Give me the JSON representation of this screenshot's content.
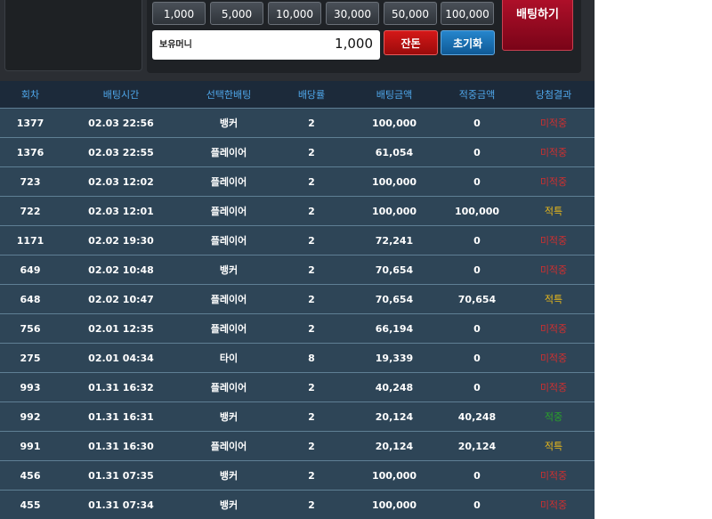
{
  "chips": [
    "1,000",
    "5,000",
    "10,000",
    "30,000",
    "50,000",
    "100,000"
  ],
  "money": {
    "label": "보유머니",
    "value": "1,000"
  },
  "buttons": {
    "change": "잔돈",
    "reset": "초기화",
    "bet": "배팅하기"
  },
  "table": {
    "headers": [
      "회차",
      "배팅시간",
      "선택한배팅",
      "배당률",
      "배팅금액",
      "적중금액",
      "당첨결과"
    ],
    "rows": [
      {
        "round": "1377",
        "time": "02.03 22:56",
        "choice": "뱅커",
        "odds": "2",
        "bet": "100,000",
        "win": "0",
        "result": "미적중",
        "status": "lose"
      },
      {
        "round": "1376",
        "time": "02.03 22:55",
        "choice": "플레이어",
        "odds": "2",
        "bet": "61,054",
        "win": "0",
        "result": "미적중",
        "status": "lose"
      },
      {
        "round": "723",
        "time": "02.03 12:02",
        "choice": "플레이어",
        "odds": "2",
        "bet": "100,000",
        "win": "0",
        "result": "미적중",
        "status": "lose"
      },
      {
        "round": "722",
        "time": "02.03 12:01",
        "choice": "플레이어",
        "odds": "2",
        "bet": "100,000",
        "win": "100,000",
        "result": "적특",
        "status": "win"
      },
      {
        "round": "1171",
        "time": "02.02 19:30",
        "choice": "플레이어",
        "odds": "2",
        "bet": "72,241",
        "win": "0",
        "result": "미적중",
        "status": "lose"
      },
      {
        "round": "649",
        "time": "02.02 10:48",
        "choice": "뱅커",
        "odds": "2",
        "bet": "70,654",
        "win": "0",
        "result": "미적중",
        "status": "lose"
      },
      {
        "round": "648",
        "time": "02.02 10:47",
        "choice": "플레이어",
        "odds": "2",
        "bet": "70,654",
        "win": "70,654",
        "result": "적특",
        "status": "win"
      },
      {
        "round": "756",
        "time": "02.01 12:35",
        "choice": "플레이어",
        "odds": "2",
        "bet": "66,194",
        "win": "0",
        "result": "미적중",
        "status": "lose"
      },
      {
        "round": "275",
        "time": "02.01 04:34",
        "choice": "타이",
        "odds": "8",
        "bet": "19,339",
        "win": "0",
        "result": "미적중",
        "status": "lose"
      },
      {
        "round": "993",
        "time": "01.31 16:32",
        "choice": "플레이어",
        "odds": "2",
        "bet": "40,248",
        "win": "0",
        "result": "미적중",
        "status": "lose"
      },
      {
        "round": "992",
        "time": "01.31 16:31",
        "choice": "뱅커",
        "odds": "2",
        "bet": "20,124",
        "win": "40,248",
        "result": "적중",
        "status": "draw"
      },
      {
        "round": "991",
        "time": "01.31 16:30",
        "choice": "플레이어",
        "odds": "2",
        "bet": "20,124",
        "win": "20,124",
        "result": "적특",
        "status": "win"
      },
      {
        "round": "456",
        "time": "01.31 07:35",
        "choice": "뱅커",
        "odds": "2",
        "bet": "100,000",
        "win": "0",
        "result": "미적중",
        "status": "lose"
      },
      {
        "round": "455",
        "time": "01.31 07:34",
        "choice": "뱅커",
        "odds": "2",
        "bet": "100,000",
        "win": "0",
        "result": "미적중",
        "status": "lose"
      }
    ]
  },
  "colors": {
    "header_text": "#4fa7ea",
    "lose": "#d12f2f",
    "win": "#e8b81b",
    "hit": "#29a329"
  }
}
